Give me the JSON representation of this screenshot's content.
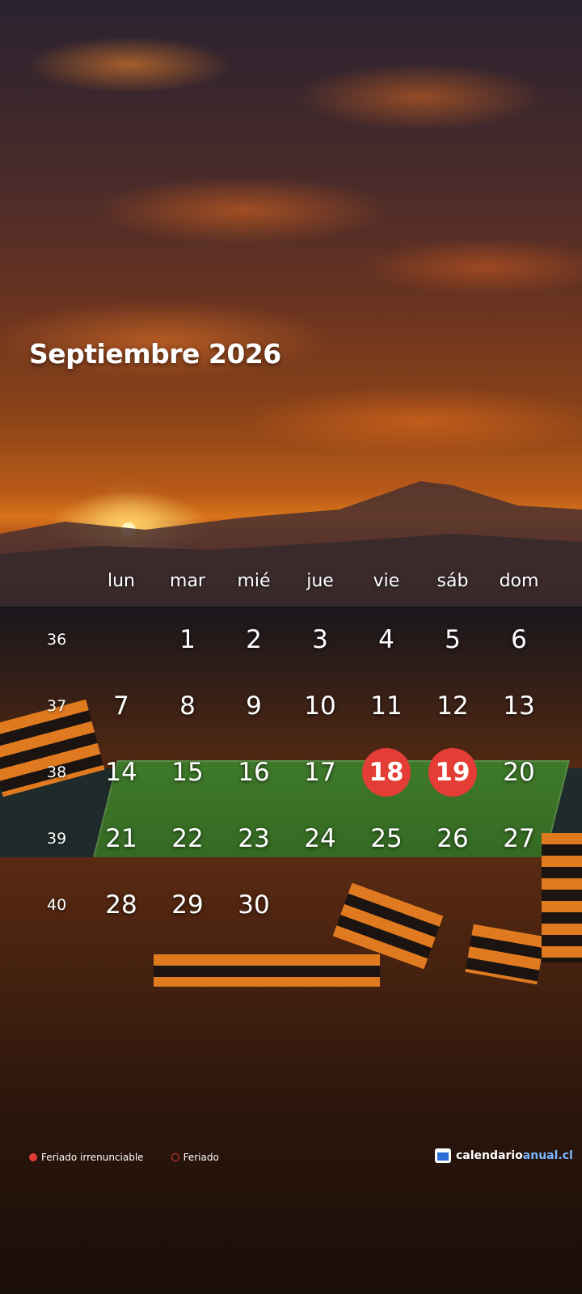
{
  "calendar": {
    "title": "Septiembre 2026",
    "weekdays": [
      "lun",
      "mar",
      "mié",
      "jue",
      "vie",
      "sáb",
      "dom"
    ],
    "weeks": [
      {
        "number": "36",
        "days": [
          "",
          "1",
          "2",
          "3",
          "4",
          "5",
          "6"
        ]
      },
      {
        "number": "37",
        "days": [
          "7",
          "8",
          "9",
          "10",
          "11",
          "12",
          "13"
        ]
      },
      {
        "number": "38",
        "days": [
          "14",
          "15",
          "16",
          "17",
          "18",
          "19",
          "20"
        ]
      },
      {
        "number": "39",
        "days": [
          "21",
          "22",
          "23",
          "24",
          "25",
          "26",
          "27"
        ]
      },
      {
        "number": "40",
        "days": [
          "28",
          "29",
          "30",
          "",
          "",
          "",
          ""
        ]
      }
    ],
    "holidays_irrenunciable": [
      "18",
      "19"
    ],
    "holiday_color": "#e43d35"
  },
  "legend": {
    "irrenunciable_label": "Feriado irrenunciable",
    "feriado_label": "Feriado"
  },
  "brand": {
    "name_part1": "calendario",
    "name_part2": "anual.cl",
    "icon": "calendar-icon"
  }
}
